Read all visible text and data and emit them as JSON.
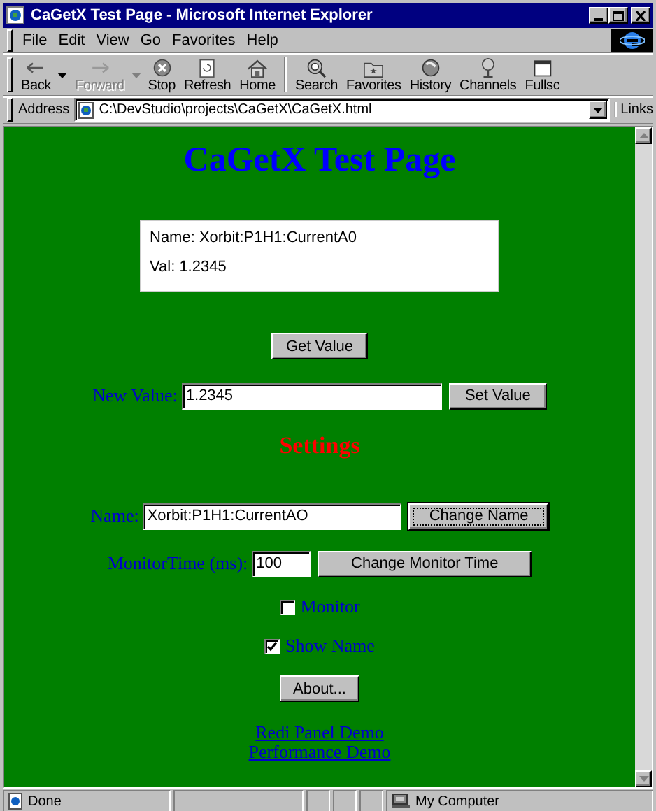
{
  "window": {
    "title": "CaGetX Test Page - Microsoft Internet Explorer"
  },
  "menu": [
    "File",
    "Edit",
    "View",
    "Go",
    "Favorites",
    "Help"
  ],
  "toolbar": [
    {
      "label": "Back",
      "kind": "back",
      "dropdown": true,
      "disabled": false
    },
    {
      "label": "Forward",
      "kind": "forward",
      "dropdown": true,
      "disabled": true
    },
    {
      "label": "Stop",
      "kind": "stop",
      "dropdown": false,
      "disabled": false
    },
    {
      "label": "Refresh",
      "kind": "refresh",
      "dropdown": false,
      "disabled": false
    },
    {
      "label": "Home",
      "kind": "home",
      "dropdown": false,
      "disabled": false
    },
    {
      "label": "Search",
      "kind": "search",
      "dropdown": false,
      "disabled": false
    },
    {
      "label": "Favorites",
      "kind": "favorites",
      "dropdown": false,
      "disabled": false
    },
    {
      "label": "History",
      "kind": "history",
      "dropdown": false,
      "disabled": false
    },
    {
      "label": "Channels",
      "kind": "channels",
      "dropdown": false,
      "disabled": false
    },
    {
      "label": "Fullsc",
      "kind": "fullscreen",
      "dropdown": false,
      "disabled": false
    }
  ],
  "address": {
    "label": "Address",
    "value": "C:\\DevStudio\\projects\\CaGetX\\CaGetX.html"
  },
  "links_label": "Links",
  "page": {
    "heading": "CaGetX Test Page",
    "info_box": {
      "name_line": "Name: Xorbit:P1H1:CurrentA0",
      "value_line": "Val: 1.2345"
    },
    "get_button": "Get Value",
    "new_value": {
      "label": "New Value:",
      "value": "1.2345",
      "button": "Set Value",
      "focused": false
    },
    "settings_heading": "Settings",
    "name_row": {
      "label": "Name:",
      "value": "Xorbit:P1H1:CurrentAO",
      "button": "Change Name",
      "focused": true
    },
    "monitor_time": {
      "label": "MonitorTime (ms):",
      "value": "100",
      "button": "Change Monitor Time",
      "focused": false
    },
    "checkboxes": [
      {
        "label": "Monitor",
        "checked": false
      },
      {
        "label": "Show Name",
        "checked": true
      }
    ],
    "about_button": "About...",
    "links": [
      "Redi Panel Demo",
      "Performance Demo"
    ]
  },
  "status_bar": {
    "text": "Done",
    "zone": "My Computer"
  }
}
